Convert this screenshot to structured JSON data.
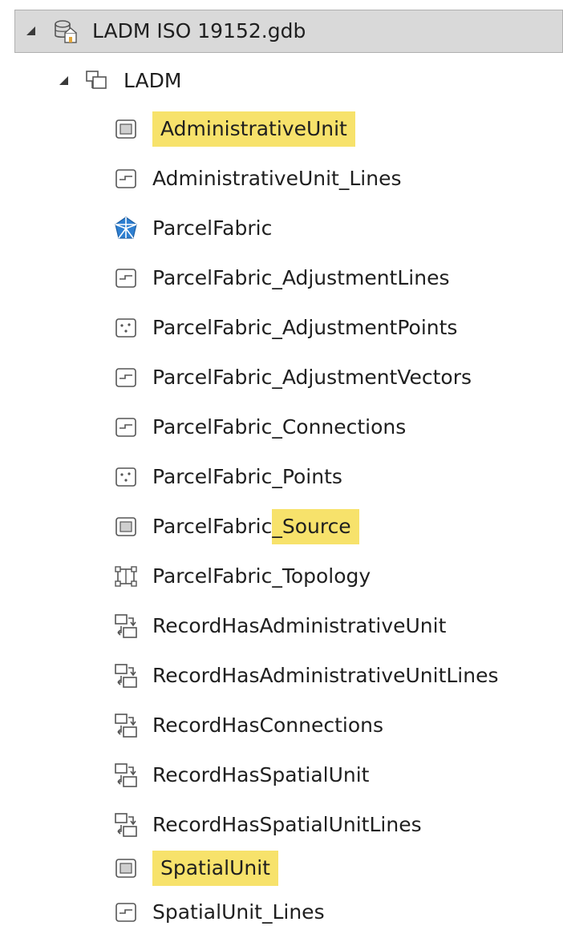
{
  "tree": {
    "root": {
      "label": "LADM ISO 19152.gdb",
      "icon": "geodatabase-icon",
      "expanded": true
    },
    "dataset": {
      "label": "LADM",
      "icon": "feature-dataset-icon",
      "expanded": true
    },
    "items": [
      {
        "label": "AdministrativeUnit",
        "icon": "polygon-feature-class-icon",
        "highlight": "full"
      },
      {
        "label": "AdministrativeUnit_Lines",
        "icon": "line-feature-class-icon"
      },
      {
        "label": "ParcelFabric",
        "icon": "parcel-fabric-icon"
      },
      {
        "label": "ParcelFabric_AdjustmentLines",
        "icon": "line-feature-class-icon"
      },
      {
        "label": "ParcelFabric_AdjustmentPoints",
        "icon": "point-feature-class-icon"
      },
      {
        "label": "ParcelFabric_AdjustmentVectors",
        "icon": "line-feature-class-icon"
      },
      {
        "label": "ParcelFabric_Connections",
        "icon": "line-feature-class-icon"
      },
      {
        "label": "ParcelFabric_Points",
        "icon": "point-feature-class-icon"
      },
      {
        "label": "ParcelFabric_Source",
        "label_prefix": "ParcelFabric",
        "label_highlight": "_Source",
        "icon": "polygon-feature-class-icon",
        "highlight": "partial"
      },
      {
        "label": "ParcelFabric_Topology",
        "icon": "topology-icon"
      },
      {
        "label": "RecordHasAdministrativeUnit",
        "icon": "relationship-class-icon"
      },
      {
        "label": "RecordHasAdministrativeUnitLines",
        "icon": "relationship-class-icon"
      },
      {
        "label": "RecordHasConnections",
        "icon": "relationship-class-icon"
      },
      {
        "label": "RecordHasSpatialUnit",
        "icon": "relationship-class-icon"
      },
      {
        "label": "RecordHasSpatialUnitLines",
        "icon": "relationship-class-icon"
      },
      {
        "label": "SpatialUnit",
        "icon": "polygon-feature-class-icon",
        "highlight": "full"
      },
      {
        "label": "SpatialUnit_Lines",
        "icon": "line-feature-class-icon"
      }
    ]
  },
  "colors": {
    "highlight": "#f7e26b",
    "selected_row": "#d9d9d9",
    "parcel_fabric_blue": "#2e7fd1",
    "text": "#1f1f1f"
  }
}
